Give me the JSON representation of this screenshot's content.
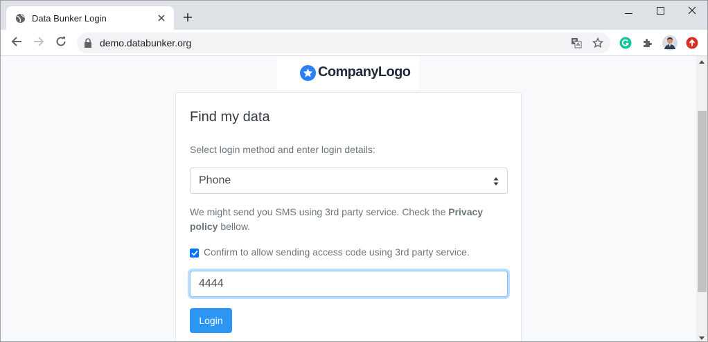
{
  "browser": {
    "tab_title": "Data Bunker Login",
    "url": "demo.databunker.org",
    "new_tab_label": "+",
    "icons": [
      "globe-icon",
      "close-icon",
      "plus-icon",
      "minimize-icon",
      "maximize-icon",
      "close-window-icon",
      "back-icon",
      "forward-icon",
      "reload-icon",
      "lock-icon",
      "translate-icon",
      "star-icon",
      "grammarly-icon",
      "extensions-icon",
      "profile-avatar",
      "update-icon"
    ]
  },
  "page": {
    "logo_text": "CompanyLogo",
    "title": "Find my data",
    "description": "Select login method and enter login details:",
    "login_method": {
      "selected": "Phone"
    },
    "notice": {
      "before": "We might send you SMS using 3rd party service. Check the ",
      "link": "Privacy policy",
      "after": " bellow."
    },
    "consent": {
      "label": "Confirm to allow sending access code using 3rd party service.",
      "checked": true
    },
    "code_input": {
      "value": "4444"
    },
    "login_button": "Login"
  },
  "colors": {
    "accent": "#2d96f3",
    "checkbox": "#0075ff",
    "logo_star": "#2a7ff7",
    "page_background": "#f8f9fa",
    "chrome_frame": "#dee1e6"
  }
}
